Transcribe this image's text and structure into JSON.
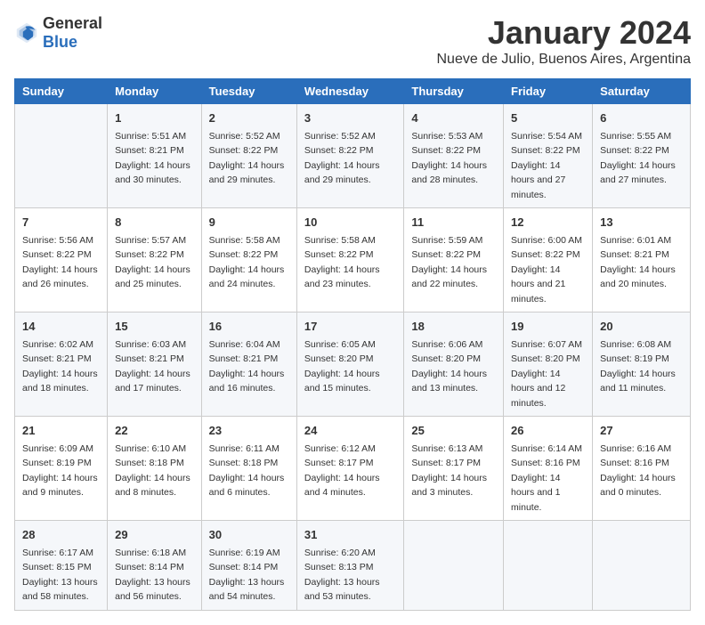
{
  "logo": {
    "text_general": "General",
    "text_blue": "Blue"
  },
  "title": "January 2024",
  "subtitle": "Nueve de Julio, Buenos Aires, Argentina",
  "header_days": [
    "Sunday",
    "Monday",
    "Tuesday",
    "Wednesday",
    "Thursday",
    "Friday",
    "Saturday"
  ],
  "weeks": [
    [
      {
        "day": "",
        "sunrise": "",
        "sunset": "",
        "daylight": ""
      },
      {
        "day": "1",
        "sunrise": "Sunrise: 5:51 AM",
        "sunset": "Sunset: 8:21 PM",
        "daylight": "Daylight: 14 hours and 30 minutes."
      },
      {
        "day": "2",
        "sunrise": "Sunrise: 5:52 AM",
        "sunset": "Sunset: 8:22 PM",
        "daylight": "Daylight: 14 hours and 29 minutes."
      },
      {
        "day": "3",
        "sunrise": "Sunrise: 5:52 AM",
        "sunset": "Sunset: 8:22 PM",
        "daylight": "Daylight: 14 hours and 29 minutes."
      },
      {
        "day": "4",
        "sunrise": "Sunrise: 5:53 AM",
        "sunset": "Sunset: 8:22 PM",
        "daylight": "Daylight: 14 hours and 28 minutes."
      },
      {
        "day": "5",
        "sunrise": "Sunrise: 5:54 AM",
        "sunset": "Sunset: 8:22 PM",
        "daylight": "Daylight: 14 hours and 27 minutes."
      },
      {
        "day": "6",
        "sunrise": "Sunrise: 5:55 AM",
        "sunset": "Sunset: 8:22 PM",
        "daylight": "Daylight: 14 hours and 27 minutes."
      }
    ],
    [
      {
        "day": "7",
        "sunrise": "Sunrise: 5:56 AM",
        "sunset": "Sunset: 8:22 PM",
        "daylight": "Daylight: 14 hours and 26 minutes."
      },
      {
        "day": "8",
        "sunrise": "Sunrise: 5:57 AM",
        "sunset": "Sunset: 8:22 PM",
        "daylight": "Daylight: 14 hours and 25 minutes."
      },
      {
        "day": "9",
        "sunrise": "Sunrise: 5:58 AM",
        "sunset": "Sunset: 8:22 PM",
        "daylight": "Daylight: 14 hours and 24 minutes."
      },
      {
        "day": "10",
        "sunrise": "Sunrise: 5:58 AM",
        "sunset": "Sunset: 8:22 PM",
        "daylight": "Daylight: 14 hours and 23 minutes."
      },
      {
        "day": "11",
        "sunrise": "Sunrise: 5:59 AM",
        "sunset": "Sunset: 8:22 PM",
        "daylight": "Daylight: 14 hours and 22 minutes."
      },
      {
        "day": "12",
        "sunrise": "Sunrise: 6:00 AM",
        "sunset": "Sunset: 8:22 PM",
        "daylight": "Daylight: 14 hours and 21 minutes."
      },
      {
        "day": "13",
        "sunrise": "Sunrise: 6:01 AM",
        "sunset": "Sunset: 8:21 PM",
        "daylight": "Daylight: 14 hours and 20 minutes."
      }
    ],
    [
      {
        "day": "14",
        "sunrise": "Sunrise: 6:02 AM",
        "sunset": "Sunset: 8:21 PM",
        "daylight": "Daylight: 14 hours and 18 minutes."
      },
      {
        "day": "15",
        "sunrise": "Sunrise: 6:03 AM",
        "sunset": "Sunset: 8:21 PM",
        "daylight": "Daylight: 14 hours and 17 minutes."
      },
      {
        "day": "16",
        "sunrise": "Sunrise: 6:04 AM",
        "sunset": "Sunset: 8:21 PM",
        "daylight": "Daylight: 14 hours and 16 minutes."
      },
      {
        "day": "17",
        "sunrise": "Sunrise: 6:05 AM",
        "sunset": "Sunset: 8:20 PM",
        "daylight": "Daylight: 14 hours and 15 minutes."
      },
      {
        "day": "18",
        "sunrise": "Sunrise: 6:06 AM",
        "sunset": "Sunset: 8:20 PM",
        "daylight": "Daylight: 14 hours and 13 minutes."
      },
      {
        "day": "19",
        "sunrise": "Sunrise: 6:07 AM",
        "sunset": "Sunset: 8:20 PM",
        "daylight": "Daylight: 14 hours and 12 minutes."
      },
      {
        "day": "20",
        "sunrise": "Sunrise: 6:08 AM",
        "sunset": "Sunset: 8:19 PM",
        "daylight": "Daylight: 14 hours and 11 minutes."
      }
    ],
    [
      {
        "day": "21",
        "sunrise": "Sunrise: 6:09 AM",
        "sunset": "Sunset: 8:19 PM",
        "daylight": "Daylight: 14 hours and 9 minutes."
      },
      {
        "day": "22",
        "sunrise": "Sunrise: 6:10 AM",
        "sunset": "Sunset: 8:18 PM",
        "daylight": "Daylight: 14 hours and 8 minutes."
      },
      {
        "day": "23",
        "sunrise": "Sunrise: 6:11 AM",
        "sunset": "Sunset: 8:18 PM",
        "daylight": "Daylight: 14 hours and 6 minutes."
      },
      {
        "day": "24",
        "sunrise": "Sunrise: 6:12 AM",
        "sunset": "Sunset: 8:17 PM",
        "daylight": "Daylight: 14 hours and 4 minutes."
      },
      {
        "day": "25",
        "sunrise": "Sunrise: 6:13 AM",
        "sunset": "Sunset: 8:17 PM",
        "daylight": "Daylight: 14 hours and 3 minutes."
      },
      {
        "day": "26",
        "sunrise": "Sunrise: 6:14 AM",
        "sunset": "Sunset: 8:16 PM",
        "daylight": "Daylight: 14 hours and 1 minute."
      },
      {
        "day": "27",
        "sunrise": "Sunrise: 6:16 AM",
        "sunset": "Sunset: 8:16 PM",
        "daylight": "Daylight: 14 hours and 0 minutes."
      }
    ],
    [
      {
        "day": "28",
        "sunrise": "Sunrise: 6:17 AM",
        "sunset": "Sunset: 8:15 PM",
        "daylight": "Daylight: 13 hours and 58 minutes."
      },
      {
        "day": "29",
        "sunrise": "Sunrise: 6:18 AM",
        "sunset": "Sunset: 8:14 PM",
        "daylight": "Daylight: 13 hours and 56 minutes."
      },
      {
        "day": "30",
        "sunrise": "Sunrise: 6:19 AM",
        "sunset": "Sunset: 8:14 PM",
        "daylight": "Daylight: 13 hours and 54 minutes."
      },
      {
        "day": "31",
        "sunrise": "Sunrise: 6:20 AM",
        "sunset": "Sunset: 8:13 PM",
        "daylight": "Daylight: 13 hours and 53 minutes."
      },
      {
        "day": "",
        "sunrise": "",
        "sunset": "",
        "daylight": ""
      },
      {
        "day": "",
        "sunrise": "",
        "sunset": "",
        "daylight": ""
      },
      {
        "day": "",
        "sunrise": "",
        "sunset": "",
        "daylight": ""
      }
    ]
  ]
}
